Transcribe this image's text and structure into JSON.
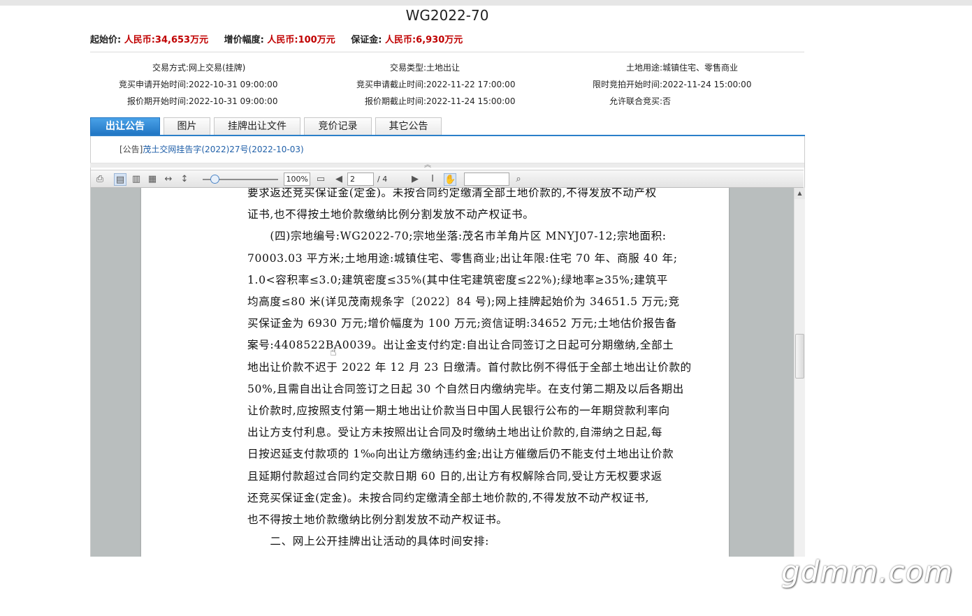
{
  "title": "WG2022-70",
  "prices": {
    "start_label": "起始价:",
    "start_value": "人民币:34,653万元",
    "increment_label": "增价幅度:",
    "increment_value": "人民币:100万元",
    "deposit_label": "保证金:",
    "deposit_value": "人民币:6,930万元"
  },
  "info": {
    "col1": [
      {
        "label": "交易方式:",
        "value": "网上交易(挂牌)"
      },
      {
        "label": "竞买申请开始时间:",
        "value": "2022-10-31 09:00:00"
      },
      {
        "label": "报价期开始时间:",
        "value": "2022-10-31 09:00:00"
      }
    ],
    "col2": [
      {
        "label": "交易类型:",
        "value": "土地出让"
      },
      {
        "label": "竞买申请截止时间:",
        "value": "2022-11-22 17:00:00"
      },
      {
        "label": "报价期截止时间:",
        "value": "2022-11-24 15:00:00"
      }
    ],
    "col3": [
      {
        "label": "土地用途:",
        "value": "城镇住宅、零售商业"
      },
      {
        "label": "限时竞拍开始时间:",
        "value": "2022-11-24 15:00:00"
      },
      {
        "label": "允许联合竞买:",
        "value": "否"
      }
    ]
  },
  "tabs": [
    "出让公告",
    "图片",
    "挂牌出让文件",
    "竞价记录",
    "其它公告"
  ],
  "notice": {
    "prefix": "[公告]",
    "link": "茂土交网挂告字(2022)27号(2022-10-03)"
  },
  "viewer": {
    "zoom": "100%",
    "page": "2",
    "total": "/ 4"
  },
  "doc_lines": [
    "要求返还竞买保证金(定金)。未按合同约定缴清全部土地价款的,不得发放不动产权",
    "证书,也不得按土地价款缴纳比例分割发放不动产权证书。",
    "　　(四)宗地编号:WG2022-70;宗地坐落:茂名市羊角片区 MNYJ07-12;宗地面积:",
    "70003.03 平方米;土地用途:城镇住宅、零售商业;出让年限:住宅 70 年、商服 40 年;",
    "1.0<容积率≤3.0;建筑密度≤35%(其中住宅建筑密度≤22%);绿地率≥35%;建筑平",
    "均高度≤80 米(详见茂南规条字〔2022〕84 号);网上挂牌起始价为 34651.5 万元;竞",
    "买保证金为 6930 万元;增价幅度为 100 万元;资信证明:34652 万元;土地估价报告备",
    "案号:4408522BA0039。出让金支付约定:自出让合同签订之日起可分期缴纳,全部土",
    "地出让价款不迟于 2022 年 12 月 23 日缴清。首付款比例不得低于全部土地出让价款的",
    "50%,且需自出让合同签订之日起 30 个自然日内缴纳完毕。在支付第二期及以后各期出",
    "让价款时,应按照支付第一期土地出让价款当日中国人民银行公布的一年期贷款利率向",
    "出让方支付利息。受让方未按照出让合同及时缴纳土地出让价款的,自滞纳之日起,每",
    "日按迟延支付款项的 1‰向出让方缴纳违约金;出让方催缴后仍不能支付土地出让价款",
    "且延期付款超过合同约定交款日期 60 日的,出让方有权解除合同,受让方无权要求返",
    "还竞买保证金(定金)。未按合同约定缴清全部土地价款的,不得发放不动产权证书,",
    "也不得按土地价款缴纳比例分割发放不动产权证书。",
    "　　二、网上公开挂牌出让活动的具体时间安排:"
  ],
  "watermark": "gdmm.com"
}
